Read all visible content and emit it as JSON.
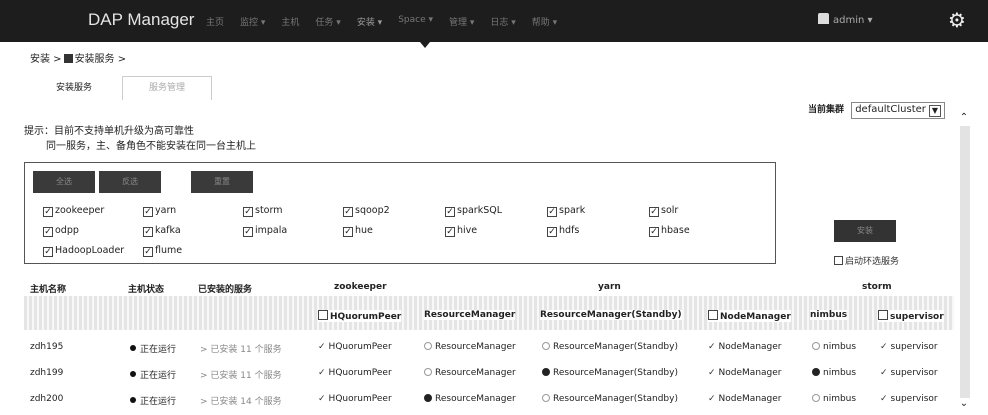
{
  "header": {
    "brand": "DAP Manager",
    "nav": [
      "主页",
      "监控 ▾",
      "主机",
      "任务 ▾",
      "安装 ▾",
      "Space ▾",
      "管理 ▾",
      "日志 ▾",
      "帮助 ▾"
    ],
    "user": "admin ▾"
  },
  "breadcrumb": {
    "root": "安装 >",
    "current": "安装服务 >"
  },
  "tabs": [
    "安装服务",
    "服务管理"
  ],
  "cluster": {
    "label": "当前集群",
    "value": "defaultCluster"
  },
  "tip": {
    "line1": "提示：目前不支持单机升级为高可靠性",
    "line2": "同一服务，主、备角色不能安装在同一台主机上"
  },
  "buttons": {
    "select_all": "全选",
    "invert": "反选",
    "reset": "重置",
    "install": "安装"
  },
  "services": [
    [
      "zookeeper",
      "yarn",
      "storm",
      "sqoop2",
      "sparkSQL",
      "spark",
      "solr"
    ],
    [
      "odpp",
      "kafka",
      "impala",
      "hue",
      "hive",
      "hdfs",
      "hbase"
    ],
    [
      "HadoopLoader",
      "flume"
    ]
  ],
  "auto_filter": "启动环选服务",
  "table": {
    "headers": {
      "host": "主机名称",
      "status": "主机状态",
      "installed": "已安装的服务",
      "zookeeper": "zookeeper",
      "yarn": "yarn",
      "storm": "storm"
    },
    "roles": [
      "HQuorumPeer",
      "ResourceManager",
      "ResourceManager(Standby)",
      "NodeManager",
      "nimbus",
      "supervisor"
    ],
    "rows": [
      {
        "host": "zdh195",
        "status": "正在运行",
        "installed": "> 已安装 11 个服务",
        "hquorum": "HQuorumPeer",
        "rm": "ResourceManager",
        "rm_standby": "ResourceManager(Standby)",
        "nm": "NodeManager",
        "nimbus": "nimbus",
        "supervisor": "supervisor"
      },
      {
        "host": "zdh199",
        "status": "正在运行",
        "installed": "> 已安装 11 个服务",
        "hquorum": "HQuorumPeer",
        "rm": "ResourceManager",
        "rm_standby": "ResourceManager(Standby)",
        "nm": "NodeManager",
        "nimbus": "nimbus",
        "supervisor": "supervisor"
      },
      {
        "host": "zdh200",
        "status": "正在运行",
        "installed": "> 已安装 14 个服务",
        "hquorum": "HQuorumPeer",
        "rm": "ResourceManager",
        "rm_standby": "ResourceManager(Standby)",
        "nm": "NodeManager",
        "nimbus": "nimbus",
        "supervisor": "supervisor"
      }
    ]
  }
}
